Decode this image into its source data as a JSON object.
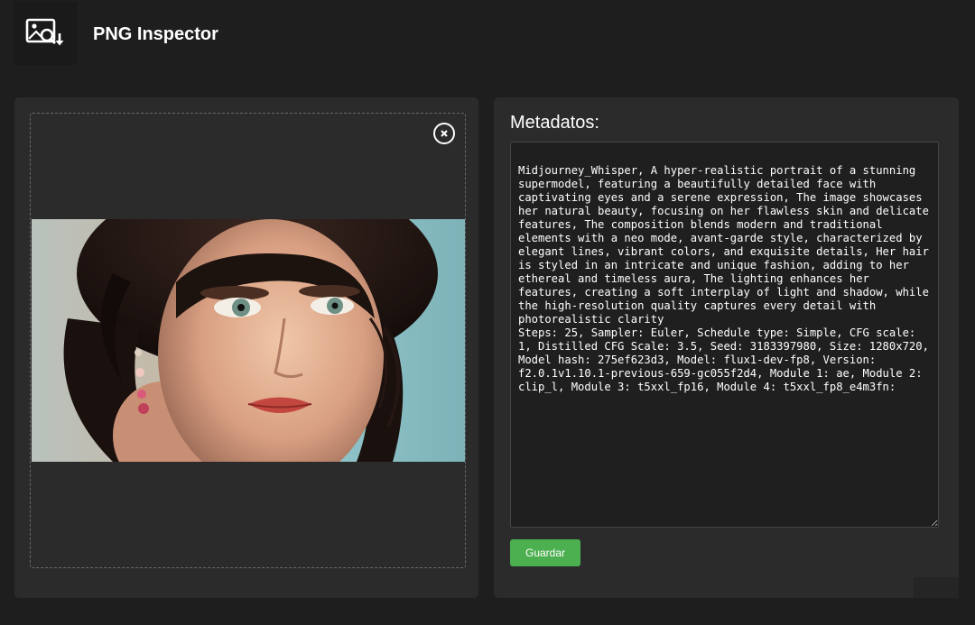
{
  "app": {
    "title": "PNG Inspector",
    "logo_icon": "image-search-download-icon"
  },
  "image_panel": {
    "close_icon": "close-icon",
    "preview_alt": "Portrait of a woman with dark curly hair and green eyes"
  },
  "metadata_panel": {
    "heading": "Metadatos:",
    "text": "Midjourney_Whisper, A hyper-realistic portrait of a stunning supermodel, featuring a beautifully detailed face with captivating eyes and a serene expression, The image showcases her natural beauty, focusing on her flawless skin and delicate features, The composition blends modern and traditional elements with a neo mode, avant-garde style, characterized by elegant lines, vibrant colors, and exquisite details, Her hair is styled in an intricate and unique fashion, adding to her ethereal and timeless aura, The lighting enhances her features, creating a soft interplay of light and shadow, while the high-resolution quality captures every detail with photorealistic clarity\nSteps: 25, Sampler: Euler, Schedule type: Simple, CFG scale: 1, Distilled CFG Scale: 3.5, Seed: 3183397980, Size: 1280x720, Model hash: 275ef623d3, Model: flux1-dev-fp8, Version: f2.0.1v1.10.1-previous-659-gc055f2d4, Module 1: ae, Module 2: clip_l, Module 3: t5xxl_fp16, Module 4: t5xxl_fp8_e4m3fn:",
    "save_label": "Guardar"
  },
  "colors": {
    "background": "#1e1e1e",
    "panel": "#2b2b2b",
    "accent_green": "#4caf50"
  }
}
